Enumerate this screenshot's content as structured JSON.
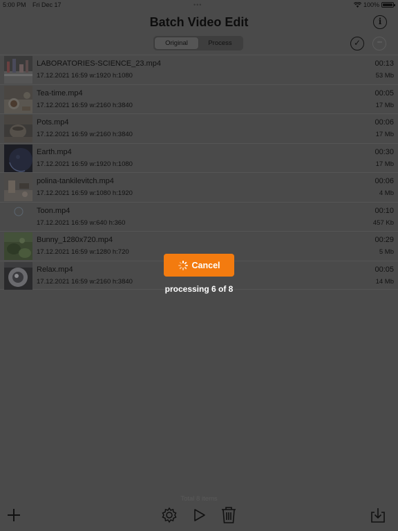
{
  "status": {
    "time": "5:00 PM",
    "date": "Fri Dec 17",
    "dots": "•••",
    "battery": "100%"
  },
  "header": {
    "title": "Batch Video Edit",
    "info_icon": "info-icon"
  },
  "segment": {
    "options": [
      "Original",
      "Process"
    ],
    "selected": 0
  },
  "toolbar_top": {
    "check_icon": "checkmark-circle-icon",
    "more_icon": "ellipsis-circle-icon"
  },
  "files": [
    {
      "name": "LABORATORIES-SCIENCE_23.mp4",
      "meta": "17.12.2021 16:59 w:1920 h:1080",
      "duration": "00:13",
      "size": "53 Mb",
      "thumb": "lab"
    },
    {
      "name": "Tea-time.mp4",
      "meta": "17.12.2021 16:59 w:2160 h:3840",
      "duration": "00:05",
      "size": "17 Mb",
      "thumb": "tea"
    },
    {
      "name": "Pots.mp4",
      "meta": "17.12.2021 16:59 w:2160 h:3840",
      "duration": "00:06",
      "size": "17 Mb",
      "thumb": "pots"
    },
    {
      "name": "Earth.mp4",
      "meta": "17.12.2021 16:59 w:1920 h:1080",
      "duration": "00:30",
      "size": "17 Mb",
      "thumb": "earth"
    },
    {
      "name": "polina-tankilevitch.mp4",
      "meta": "17.12.2021 16:59 w:1080 h:1920",
      "duration": "00:06",
      "size": "4 Mb",
      "thumb": "polina"
    },
    {
      "name": "Toon.mp4",
      "meta": "17.12.2021 16:59 w:640 h:360",
      "duration": "00:10",
      "size": "457 Kb",
      "thumb": "toon"
    },
    {
      "name": "Bunny_1280x720.mp4",
      "meta": "17.12.2021 16:59 w:1280 h:720",
      "duration": "00:29",
      "size": "5 Mb",
      "thumb": "bunny"
    },
    {
      "name": "Relax.mp4",
      "meta": "17.12.2021 16:59 w:2160 h:3840",
      "duration": "00:05",
      "size": "14 Mb",
      "thumb": "relax"
    }
  ],
  "overlay": {
    "cancel_label": "Cancel",
    "processing_text": "processing 6 of 8",
    "accent": "#f37b0f"
  },
  "footer": {
    "total_text": "Total 8 items",
    "icons": [
      "plus-icon",
      "gear-icon",
      "play-icon",
      "trash-icon",
      "download-icon"
    ]
  }
}
